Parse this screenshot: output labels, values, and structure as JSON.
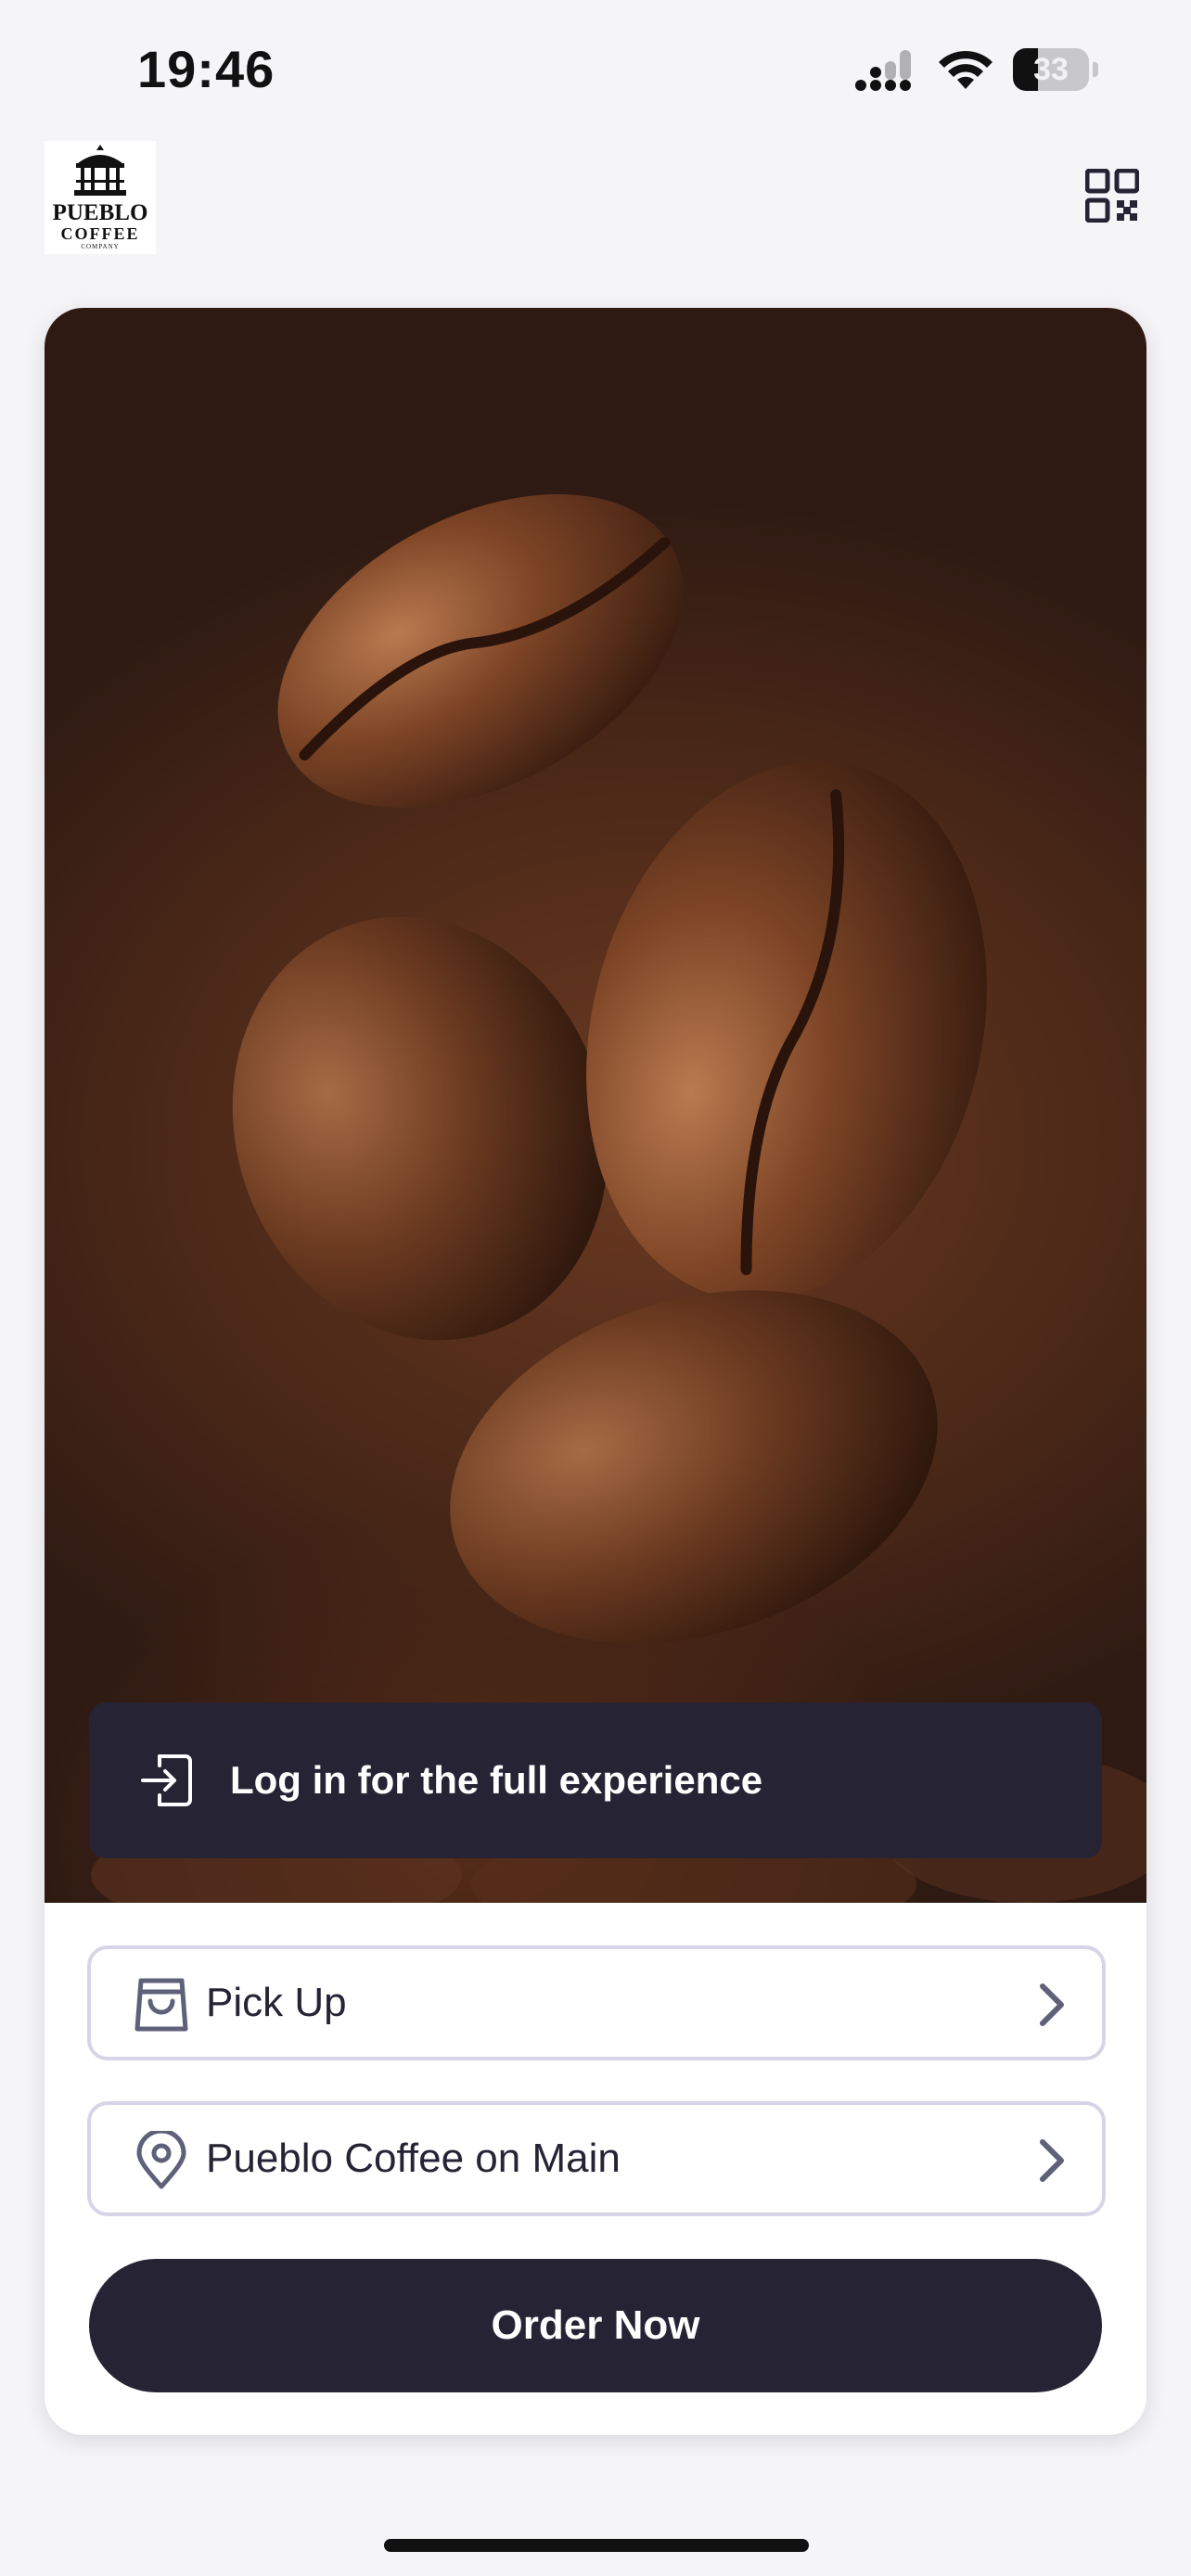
{
  "status_bar": {
    "time": "19:46",
    "battery_percent": 33
  },
  "header": {
    "logo": {
      "line1": "PUEBLO",
      "line2": "COFFEE",
      "line3": "COMPANY"
    },
    "qr_icon": "qr-code-icon"
  },
  "hero": {
    "image": "coffee-beans-falling-photo",
    "login_banner": {
      "icon": "login-icon",
      "text": "Log in for the full experience"
    }
  },
  "order_options": [
    {
      "icon": "shopping-bag-icon",
      "label": "Pick Up",
      "chevron": "chevron-right-icon"
    },
    {
      "icon": "location-pin-icon",
      "label": "Pueblo Coffee on Main",
      "chevron": "chevron-right-icon"
    }
  ],
  "order_button": {
    "label": "Order Now"
  },
  "colors": {
    "primary": "#262335",
    "border": "#d6d4e6",
    "background": "#f5f5f8"
  }
}
